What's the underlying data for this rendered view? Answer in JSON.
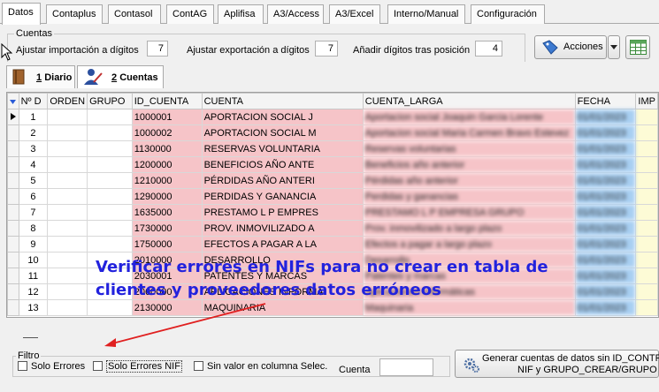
{
  "tabs": [
    "Datos",
    "Contaplus",
    "Contasol",
    "ContAG",
    "Aplifisa",
    "A3/Access",
    "A3/Excel",
    "Interno/Manual",
    "Configuración"
  ],
  "active_tab": "Datos",
  "cuentas_group": {
    "title": "Cuentas",
    "import_label": "Ajustar importación a dígitos",
    "import_value": "7",
    "export_label": "Ajustar exportación a dígitos",
    "export_value": "7",
    "add_label": "Añadir dígitos tras posición",
    "add_value": "4"
  },
  "toolbar": {
    "acciones_label": "Acciones"
  },
  "subtabs": [
    {
      "num": "1",
      "label": "Diario"
    },
    {
      "num": "2",
      "label": "Cuentas"
    }
  ],
  "grid": {
    "columns": [
      "Nº D",
      "ORDEN",
      "GRUPO",
      "ID_CUENTA",
      "CUENTA",
      "CUENTA_LARGA",
      "FECHA",
      "IMP"
    ],
    "rows": [
      {
        "n": "1",
        "id": "1000001",
        "cuenta": "APORTACION SOCIAL J"
      },
      {
        "n": "2",
        "id": "1000002",
        "cuenta": "APORTACION SOCIAL M"
      },
      {
        "n": "3",
        "id": "1130000",
        "cuenta": "RESERVAS VOLUNTARIA"
      },
      {
        "n": "4",
        "id": "1200000",
        "cuenta": "BENEFICIOS AÑO ANTE"
      },
      {
        "n": "5",
        "id": "1210000",
        "cuenta": "PÉRDIDAS AÑO ANTERI"
      },
      {
        "n": "6",
        "id": "1290000",
        "cuenta": "PERDIDAS Y GANANCIA"
      },
      {
        "n": "7",
        "id": "1635000",
        "cuenta": "PRESTAMO L P  EMPRES"
      },
      {
        "n": "8",
        "id": "1730000",
        "cuenta": "PROV. INMOVILIZADO A"
      },
      {
        "n": "9",
        "id": "1750000",
        "cuenta": "EFECTOS A PAGAR A LA"
      },
      {
        "n": "10",
        "id": "2010000",
        "cuenta": "DESARROLLO"
      },
      {
        "n": "11",
        "id": "2030001",
        "cuenta": "PATENTES Y MARCAS"
      },
      {
        "n": "12",
        "id": "2060000",
        "cuenta": "APLICACIONES INFORMA"
      },
      {
        "n": "13",
        "id": "2130000",
        "cuenta": "MAQUINARIA"
      }
    ]
  },
  "filtro": {
    "title": "Filtro",
    "solo_errores": "Solo Errores",
    "solo_errores_checked": false,
    "solo_errores_nif": "Solo Errores NIF",
    "solo_errores_nif_checked": true,
    "sin_valor": "Sin valor en columna Selec.",
    "sin_valor_checked": false,
    "cuenta_label": "Cuenta",
    "cuenta_value": ""
  },
  "generar_button": {
    "line1": "Generar cuentas de datos sin ID_CONTRA",
    "line2": "NIF y GRUPO_CREAR/GRUPO"
  },
  "annotation": {
    "line1": "Verificar errores en NIFs para no crear en tabla de",
    "line2": "clientes y proveedores datos erróneos",
    "color": "#2222dd",
    "arrow_color": "#e02020"
  }
}
